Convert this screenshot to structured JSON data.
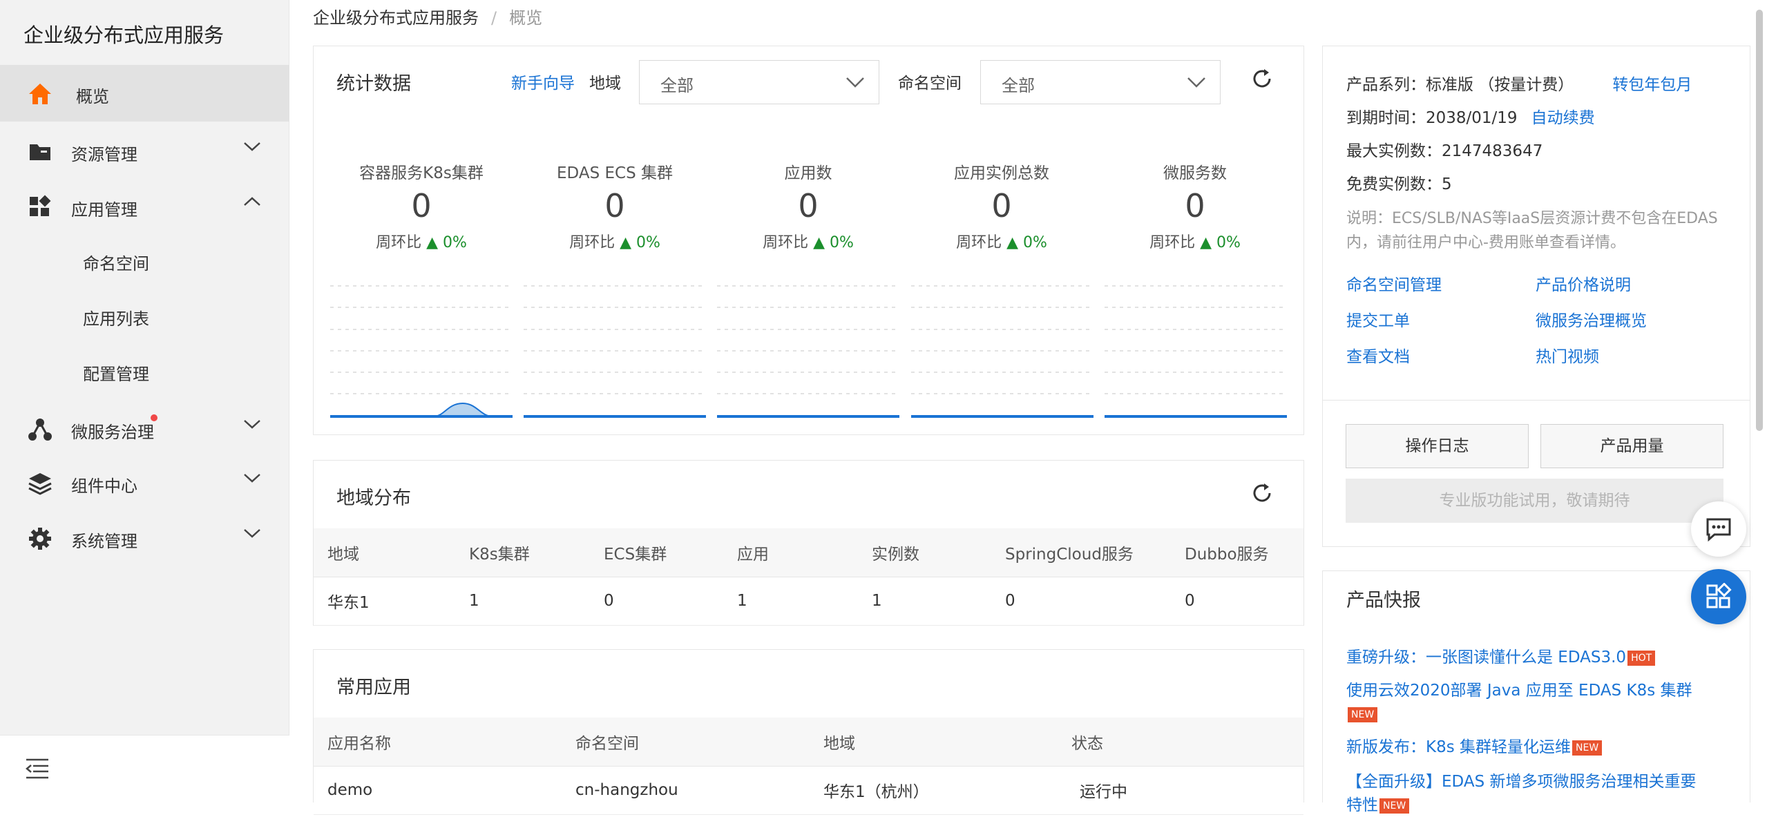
{
  "sidebar": {
    "title": "企业级分布式应用服务",
    "items": [
      {
        "label": "概览"
      },
      {
        "label": "资源管理"
      },
      {
        "label": "应用管理"
      },
      {
        "label": "微服务治理"
      },
      {
        "label": "组件中心"
      },
      {
        "label": "系统管理"
      }
    ],
    "subitems": [
      {
        "label": "命名空间"
      },
      {
        "label": "应用列表"
      },
      {
        "label": "配置管理"
      }
    ],
    "accent": "#ff6a00"
  },
  "breadcrumb": {
    "root": "企业级分布式应用服务",
    "sep": "/",
    "current": "概览"
  },
  "stats": {
    "title": "统计数据",
    "guide": "新手向导",
    "region_label": "地域",
    "region_value": "全部",
    "ns_label": "命名空间",
    "ns_value": "全部",
    "cards": [
      {
        "label": "容器服务K8s集群",
        "value": "0",
        "change_label": "周环比",
        "change": "0%"
      },
      {
        "label": "EDAS ECS 集群",
        "value": "0",
        "change_label": "周环比",
        "change": "0%"
      },
      {
        "label": "应用数",
        "value": "0",
        "change_label": "周环比",
        "change": "0%"
      },
      {
        "label": "应用实例总数",
        "value": "0",
        "change_label": "周环比",
        "change": "0%"
      },
      {
        "label": "微服务数",
        "value": "0",
        "change_label": "周环比",
        "change": "0%"
      }
    ]
  },
  "region_dist": {
    "title": "地域分布",
    "headers": [
      "地域",
      "K8s集群",
      "ECS集群",
      "应用",
      "实例数",
      "SpringCloud服务",
      "Dubbo服务"
    ],
    "rows": [
      [
        "华东1",
        "1",
        "0",
        "1",
        "1",
        "0",
        "0"
      ]
    ]
  },
  "common_apps": {
    "title": "常用应用",
    "headers": [
      "应用名称",
      "命名空间",
      "地域",
      "状态"
    ],
    "rows": [
      [
        "demo",
        "cn-hangzhou",
        "华东1（杭州）",
        "运行中"
      ]
    ]
  },
  "product": {
    "series_label": "产品系列：",
    "series_value": "标准版 （按量计费）",
    "series_link": "转包年包月",
    "expire_label": "到期时间：",
    "expire_value": "2038/01/19",
    "expire_link": "自动续费",
    "max_label": "最大实例数：",
    "max_value": "2147483647",
    "free_label": "免费实例数：",
    "free_value": "5",
    "note": "说明：ECS/SLB/NAS等IaaS层资源计费不包含在EDAS内，请前往用户中心-费用账单查看详情。",
    "links": [
      "命名空间管理",
      "产品价格说明",
      "提交工单",
      "微服务治理概览",
      "查看文档",
      "热门视频"
    ],
    "btn_log": "操作日志",
    "btn_usage": "产品用量",
    "btn_pro": "专业版功能试用，敬请期待"
  },
  "news": {
    "title": "产品快报",
    "items": [
      {
        "text": "重磅升级：一张图读懂什么是 EDAS3.0",
        "tag": "HOT"
      },
      {
        "text": "使用云效2020部署 Java 应用至 EDAS K8s 集群",
        "tag": "NEW"
      },
      {
        "text": "新版发布：K8s 集群轻量化运维",
        "tag": "NEW"
      },
      {
        "text": "【全面升级】EDAS 新增多项微服务治理相关重要特性",
        "tag": "NEW"
      }
    ]
  }
}
